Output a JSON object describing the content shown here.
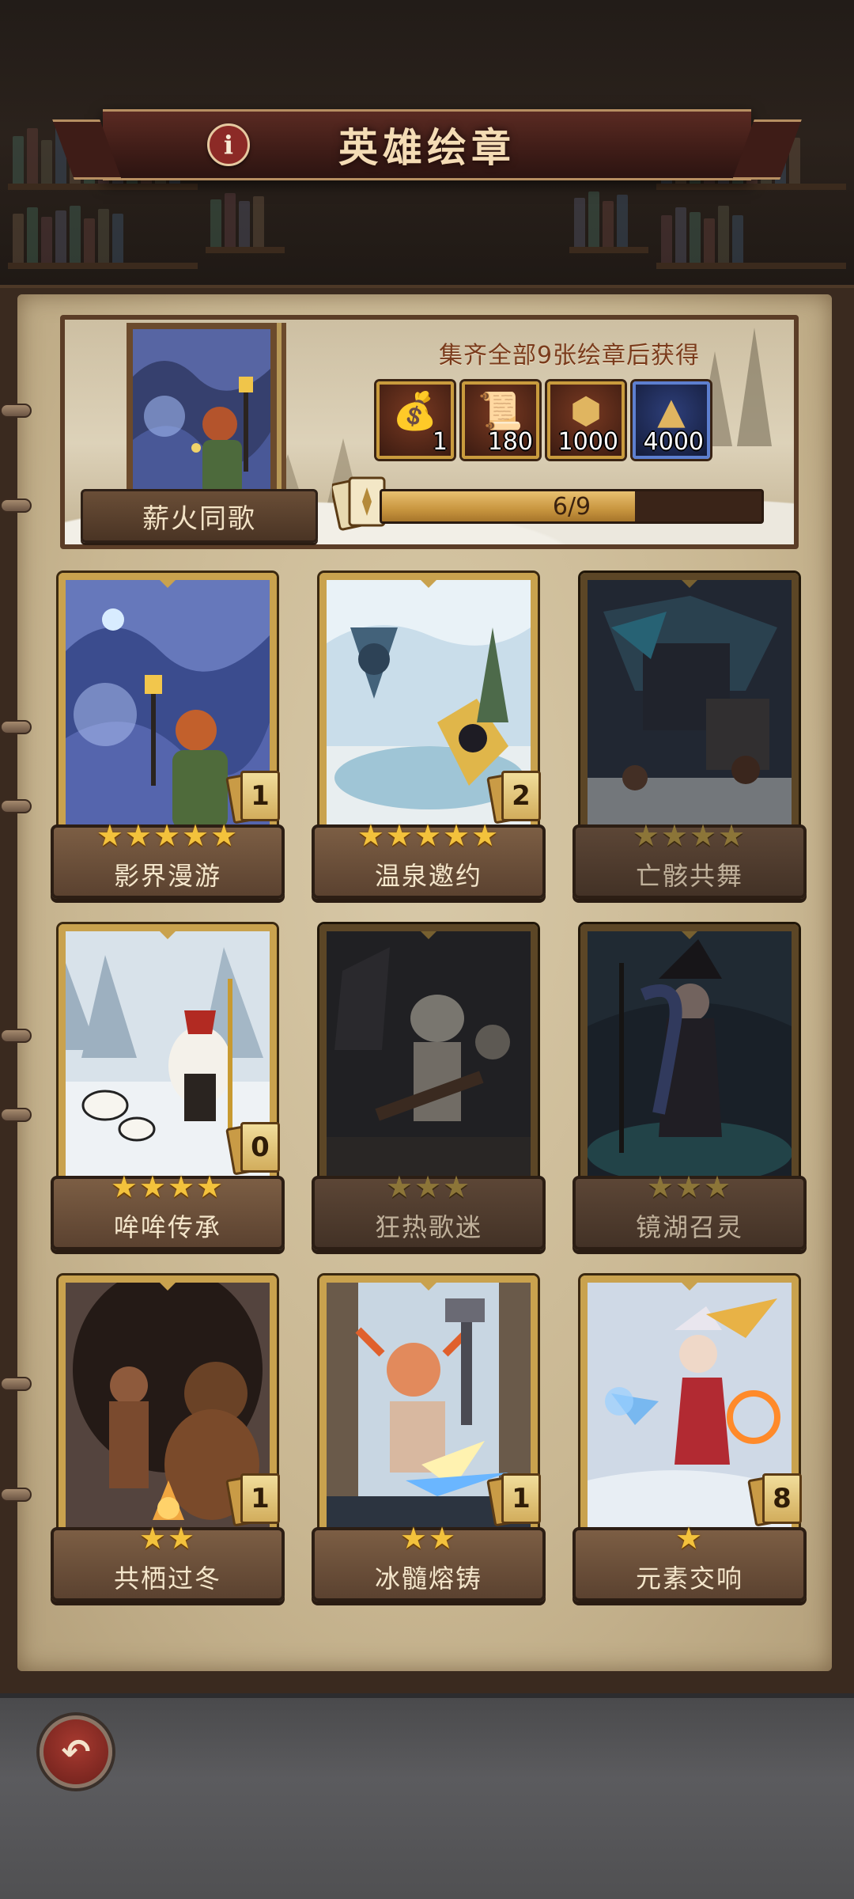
{
  "header": {
    "title": "英雄绘章",
    "info_icon": "i"
  },
  "set": {
    "name": "薪火同歌",
    "reward_title": "集齐全部9张绘章后获得",
    "rewards": [
      {
        "icon": "money-bag-icon",
        "glyph": "💰",
        "count": "1"
      },
      {
        "icon": "scroll-icon",
        "glyph": "📜",
        "count": "180"
      },
      {
        "icon": "ore-icon",
        "glyph": "⬢",
        "count": "1000"
      },
      {
        "icon": "crystal-pile-icon",
        "glyph": "▲",
        "count": "4000"
      }
    ],
    "progress_text": "6/9",
    "progress_fraction": 0.667
  },
  "cards": [
    {
      "name": "影界漫游",
      "stars": "★★★★★",
      "count": "1",
      "locked": false
    },
    {
      "name": "温泉邀约",
      "stars": "★★★★★",
      "count": "2",
      "locked": false
    },
    {
      "name": "亡骸共舞",
      "stars": "★★★★",
      "count": "",
      "locked": true
    },
    {
      "name": "哞哞传承",
      "stars": "★★★★",
      "count": "0",
      "locked": false
    },
    {
      "name": "狂热歌迷",
      "stars": "★★★",
      "count": "",
      "locked": true
    },
    {
      "name": "镜湖召灵",
      "stars": "★★★",
      "count": "",
      "locked": true
    },
    {
      "name": "共栖过冬",
      "stars": "★★",
      "count": "1",
      "locked": false
    },
    {
      "name": "冰髓熔铸",
      "stars": "★★",
      "count": "1",
      "locked": false
    },
    {
      "name": "元素交响",
      "stars": "★",
      "count": "8",
      "locked": false
    }
  ],
  "footer": {
    "back_glyph": "↶"
  },
  "colors": {
    "gold": "#c9a24e",
    "title_red": "#5a2a22",
    "parchment": "#d8c9a8",
    "star": "#f3c23c"
  }
}
